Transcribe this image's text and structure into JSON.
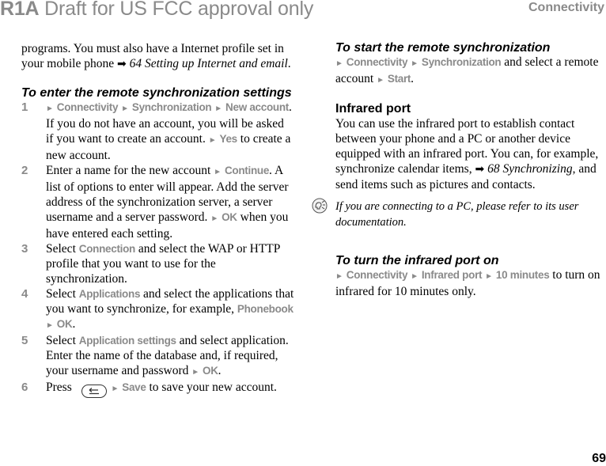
{
  "header": {
    "draft_code": "R1A",
    "draft_text": "Draft for US FCC approval only",
    "section_title": "Connectivity"
  },
  "left_column": {
    "intro": {
      "text1": "programs. You must also have a Internet profile set in your mobile phone",
      "arrow_icon": "➡",
      "ref": "64 Setting up Internet and email",
      "end": "."
    },
    "heading": "To enter the remote synchronization settings",
    "steps": [
      {
        "number": "1",
        "path": [
          "Connectivity",
          "Synchronization",
          "New account"
        ],
        "text": ". If you do not have an account, you will be asked if you want to create an account.",
        "action": "Yes",
        "action_text": " to create a new account."
      },
      {
        "number": "2",
        "text1": "Enter a name for the new account",
        "action1": "Continue",
        "text2": ". A list of options to enter will appear. Add the server address of the synchronization server, a server username and a server password.",
        "action2": "OK",
        "text3": " when you have entered each setting."
      },
      {
        "number": "3",
        "text1": "Select ",
        "item": "Connection",
        "text2": " and select the WAP or HTTP profile that you want to use for the synchronization."
      },
      {
        "number": "4",
        "text1": "Select ",
        "item": "Applications",
        "text2": " and select the applications that you want to synchronize, for example, ",
        "item2": "Phonebook",
        "action": "OK",
        "end": "."
      },
      {
        "number": "5",
        "text1": "Select ",
        "item": "Application settings",
        "text2": " and select application. Enter the name of the database and, if required, your username and password",
        "action": "OK",
        "end": "."
      },
      {
        "number": "6",
        "text1": "Press",
        "key_icon": "back-key",
        "action": "Save",
        "text2": " to save your new account."
      }
    ]
  },
  "right_column": {
    "start_sync": {
      "heading": "To start the remote synchronization",
      "path": [
        "Connectivity",
        "Synchronization"
      ],
      "text1": " and select a remote account",
      "action": "Start",
      "end": "."
    },
    "infrared": {
      "heading": "Infrared port",
      "text1": "You can use the infrared port to establish contact between your phone and a PC or another device equipped with an infrared port. You can, for example, synchronize calendar items,",
      "arrow_icon": "➡",
      "ref": "68 Synchronizing",
      "text2": ", and send items such as pictures and contacts."
    },
    "note": {
      "icon": "lightbulb-tip-icon",
      "text": "If you are connecting to a PC, please refer to its user documentation."
    },
    "turn_on": {
      "heading": "To turn the infrared port on",
      "path": [
        "Connectivity",
        "Infrared port",
        "10 minutes"
      ],
      "text": " to turn on infrared for 10 minutes only."
    }
  },
  "footer": {
    "page_number": "69"
  },
  "symbols": {
    "triangle": "►"
  }
}
